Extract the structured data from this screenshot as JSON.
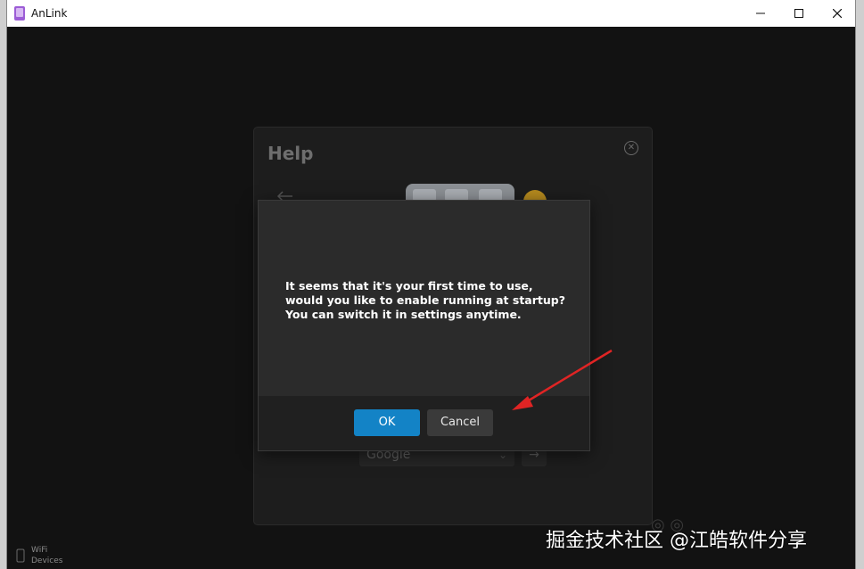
{
  "window": {
    "title": "AnLink",
    "controls": {
      "minimize_icon": "minimize-icon",
      "maximize_icon": "maximize-icon",
      "close_icon": "close-icon"
    }
  },
  "help_panel": {
    "title": "Help",
    "search": {
      "engine": "Google"
    }
  },
  "dialog": {
    "message": "It seems that it's your first time to use, would you like to enable running at startup? You can switch it in settings anytime.",
    "ok_label": "OK",
    "cancel_label": "Cancel"
  },
  "sidebar": {
    "wifi_devices_line1": "WiFi",
    "wifi_devices_line2": "Devices"
  },
  "watermark": {
    "text": "掘金技术社区 @江皓软件分享"
  },
  "colors": {
    "accent": "#1383c6",
    "annotation_arrow": "#e02424"
  }
}
